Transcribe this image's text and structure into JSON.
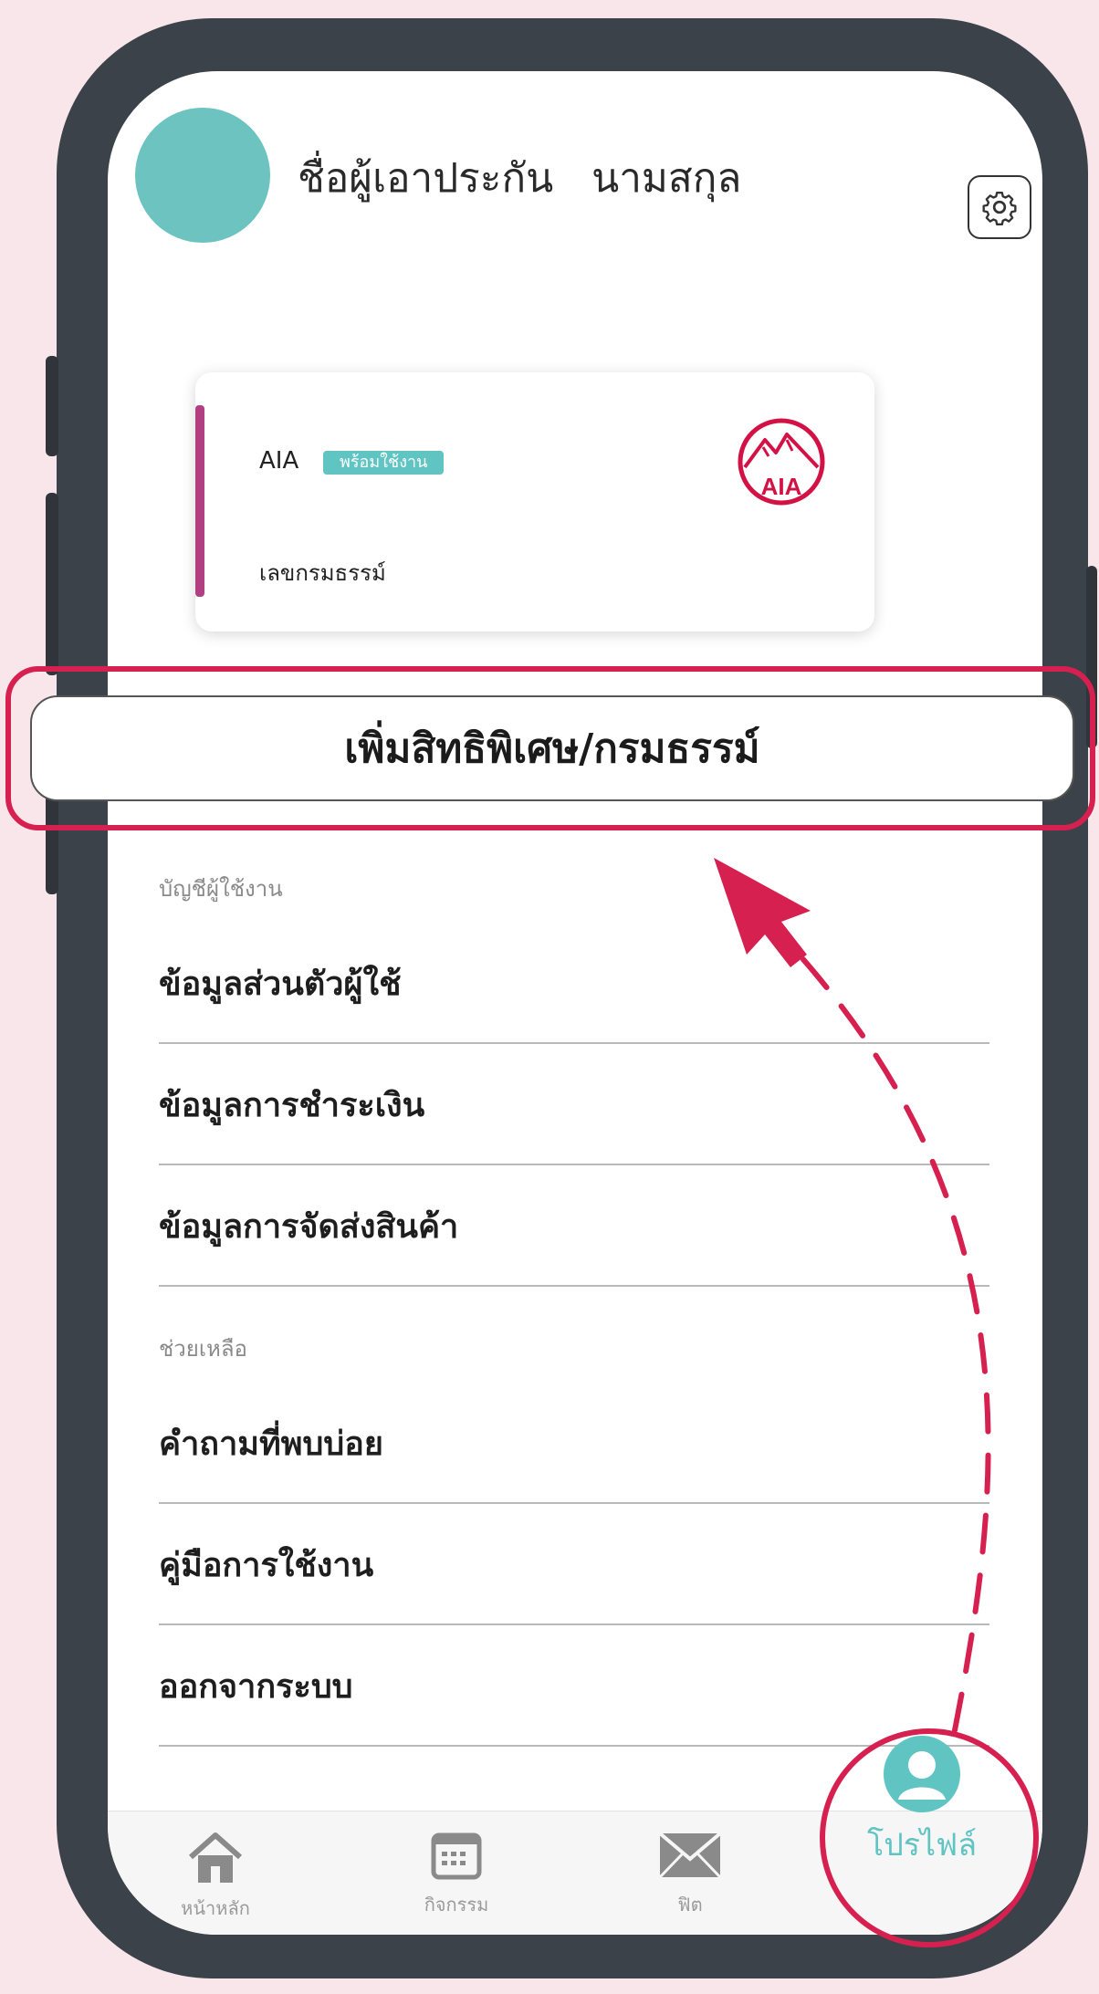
{
  "header": {
    "user_name": "ชื่อผู้เอาประกัน   นามสกุล"
  },
  "policy_card": {
    "brand": "AIA",
    "status": "พร้อมใช้งาน",
    "policy_label": "เลขกรมธรรม์",
    "logo_text": "AIA"
  },
  "add_button": {
    "label": "เพิ่มสิทธิพิเศษ/กรมธรรม์"
  },
  "account_section": {
    "title": "บัญชีผู้ใช้งาน",
    "items": [
      {
        "label": "ข้อมูลส่วนตัวผู้ใช้"
      },
      {
        "label": "ข้อมูลการชำระเงิน"
      },
      {
        "label": "ข้อมูลการจัดส่งสินค้า"
      }
    ]
  },
  "help_section": {
    "title": "ช่วยเหลือ",
    "items": [
      {
        "label": "คำถามที่พบบ่อย"
      },
      {
        "label": "คู่มือการใช้งาน"
      },
      {
        "label": "ออกจากระบบ"
      }
    ]
  },
  "bottom_nav": {
    "home": "หน้าหลัก",
    "activity": "กิจกรรม",
    "inbox": "ฟิต",
    "profile": "โปรไฟล์"
  },
  "colors": {
    "accent_teal": "#5fc4c2",
    "highlight_red": "#d62050",
    "card_accent": "#b0407f",
    "background_pink": "#f9e6ea"
  },
  "icons": {
    "settings": "gear-icon",
    "home": "home-icon",
    "activity": "calendar-icon",
    "inbox": "mail-icon",
    "profile": "user-icon"
  }
}
